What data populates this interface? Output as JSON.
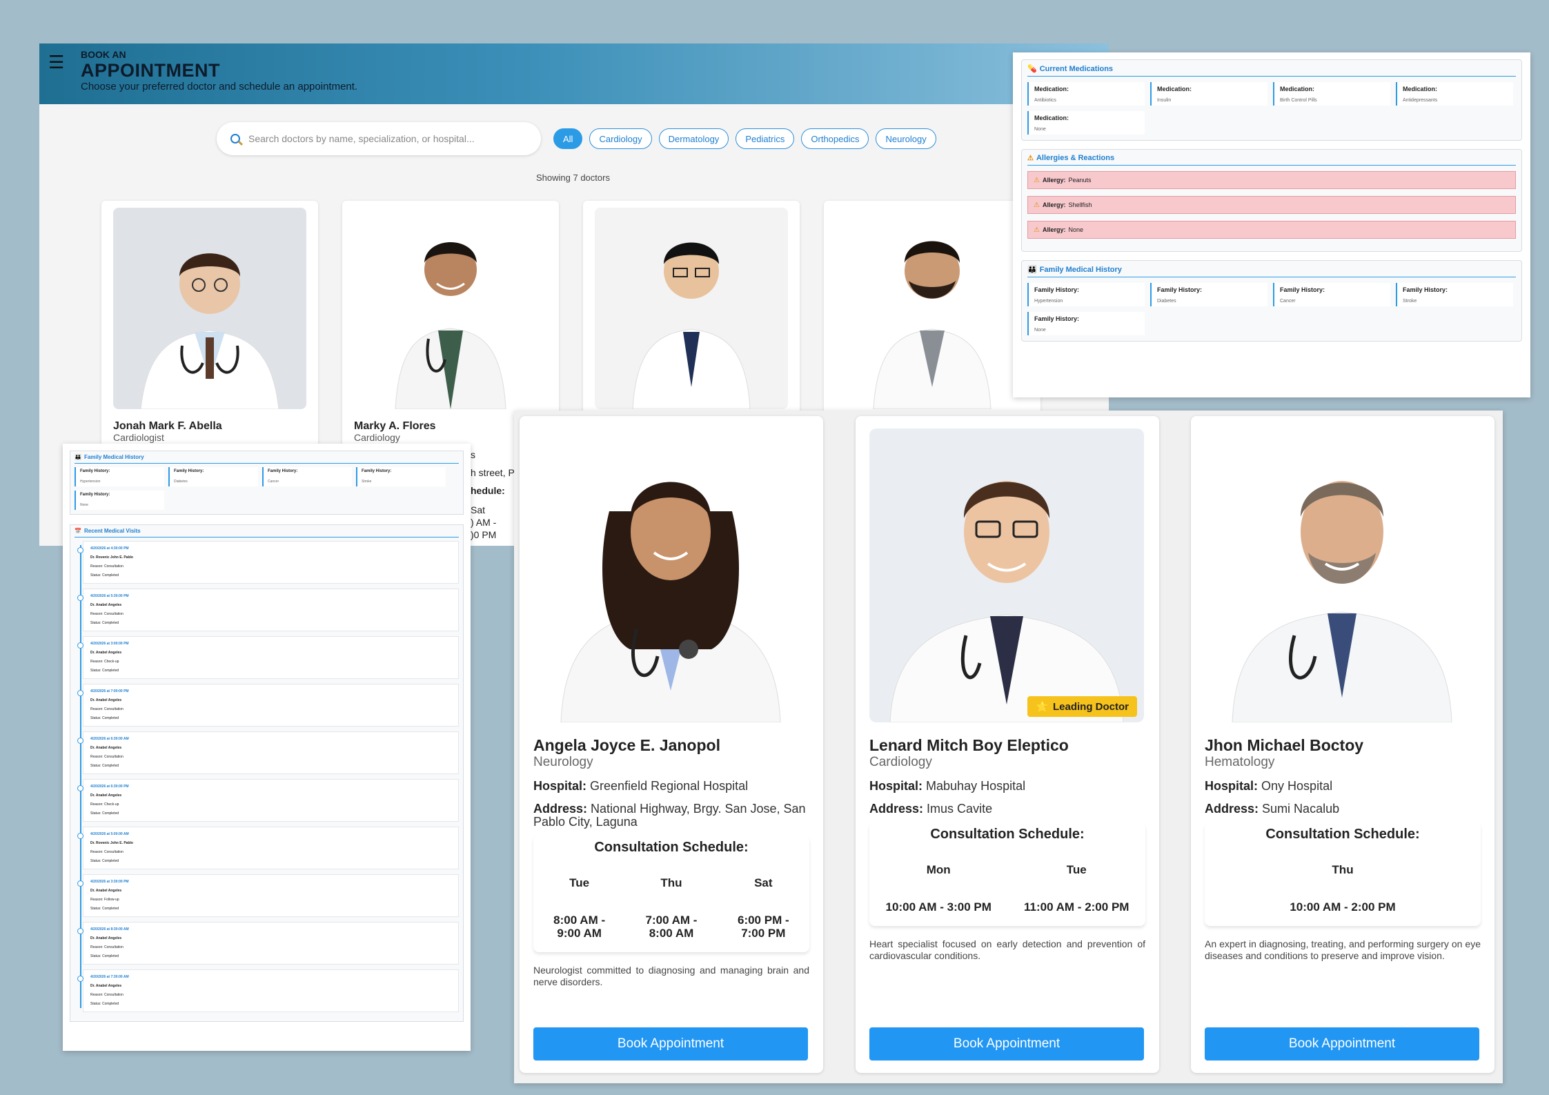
{
  "header": {
    "menu_icon": "hamburger-icon",
    "small_title": "BOOK AN",
    "title": "APPOINTMENT",
    "subtitle": "Choose your preferred doctor and schedule an appointment."
  },
  "search": {
    "placeholder": "Search doctors by name, specialization, or hospital..."
  },
  "filters": [
    "All",
    "Cardiology",
    "Dermatology",
    "Pediatrics",
    "Orthopedics",
    "Neurology"
  ],
  "showing": "Showing 7 doctors",
  "top_doctors": [
    {
      "name": "Jonah Mark F. Abella",
      "specialty": "Cardiologist"
    },
    {
      "name": "Marky A. Flores",
      "specialty": "Cardiology"
    },
    {
      "name": "",
      "specialty": ""
    },
    {
      "name": "",
      "specialty": ""
    }
  ],
  "peek": {
    "line1": "s",
    "line2": "h street, Pha",
    "line3": "hedule:",
    "line4": "Sat",
    "line5": ") AM -",
    "line6": ")0 PM"
  },
  "right_panel": {
    "medications_title": "Current Medications",
    "medications": [
      {
        "label": "Medication:",
        "value": "Antibiotics"
      },
      {
        "label": "Medication:",
        "value": "Insulin"
      },
      {
        "label": "Medication:",
        "value": "Birth Control Pills"
      },
      {
        "label": "Medication:",
        "value": "Antidepressants"
      },
      {
        "label": "Medication:",
        "value": "None"
      }
    ],
    "allergies_title": "Allergies & Reactions",
    "allergies": [
      {
        "label": "Allergy:",
        "value": "Peanuts"
      },
      {
        "label": "Allergy:",
        "value": "Shellfish"
      },
      {
        "label": "Allergy:",
        "value": "None"
      }
    ],
    "family_title": "Family Medical History",
    "family": [
      {
        "label": "Family History:",
        "value": "Hypertension"
      },
      {
        "label": "Family History:",
        "value": "Diabetes"
      },
      {
        "label": "Family History:",
        "value": "Cancer"
      },
      {
        "label": "Family History:",
        "value": "Stroke"
      },
      {
        "label": "Family History:",
        "value": "None"
      }
    ]
  },
  "left_panel": {
    "family_title": "Family Medical History",
    "family": [
      {
        "label": "Family History:",
        "value": "Hypertension"
      },
      {
        "label": "Family History:",
        "value": "Diabetes"
      },
      {
        "label": "Family History:",
        "value": "Cancer"
      },
      {
        "label": "Family History:",
        "value": "Stroke"
      },
      {
        "label": "Family History:",
        "value": "None"
      }
    ],
    "visits_title": "Recent Medical Visits",
    "visits": [
      {
        "date": "4/20/2026 at 4:30:00 PM",
        "doctor": "Dr. Rovenic John E. Pablo",
        "reason": "Reason: Consultation",
        "status": "Status: Completed"
      },
      {
        "date": "4/20/2026 at 5:30:00 PM",
        "doctor": "Dr. Anabel Angeles",
        "reason": "Reason: Consultation",
        "status": "Status: Completed"
      },
      {
        "date": "4/20/2026 at 3:00:00 PM",
        "doctor": "Dr. Anabel Angeles",
        "reason": "Reason: Check-up",
        "status": "Status: Completed"
      },
      {
        "date": "4/20/2026 at 7:00:00 PM",
        "doctor": "Dr. Anabel Angeles",
        "reason": "Reason: Consultation",
        "status": "Status: Completed"
      },
      {
        "date": "4/20/2026 at 6:30:00 AM",
        "doctor": "Dr. Anabel Angeles",
        "reason": "Reason: Consultation",
        "status": "Status: Completed"
      },
      {
        "date": "4/20/2026 at 6:30:00 PM",
        "doctor": "Dr. Anabel Angeles",
        "reason": "Reason: Check-up",
        "status": "Status: Completed"
      },
      {
        "date": "4/20/2026 at 5:00:00 AM",
        "doctor": "Dr. Rovenic John E. Pablo",
        "reason": "Reason: Consultation",
        "status": "Status: Completed"
      },
      {
        "date": "4/20/2026 at 3:30:00 PM",
        "doctor": "Dr. Anabel Angeles",
        "reason": "Reason: Follow-up",
        "status": "Status: Completed"
      },
      {
        "date": "4/20/2026 at 8:30:00 AM",
        "doctor": "Dr. Anabel Angeles",
        "reason": "Reason: Consultation",
        "status": "Status: Completed"
      },
      {
        "date": "4/20/2026 at 7:30:00 AM",
        "doctor": "Dr. Anabel Angeles",
        "reason": "Reason: Consultation",
        "status": "Status: Completed"
      }
    ]
  },
  "cards": [
    {
      "name": "Angela Joyce E. Janopol",
      "specialty": "Neurology",
      "hospital_label": "Hospital:",
      "hospital": "Greenfield Regional Hospital",
      "address_label": "Address:",
      "address": "National Highway, Brgy. San Jose, San Pablo City, Laguna",
      "schedule_title": "Consultation Schedule:",
      "days": [
        {
          "day": "Tue",
          "time": "8:00 AM - 9:00 AM"
        },
        {
          "day": "Thu",
          "time": "7:00 AM - 8:00 AM"
        },
        {
          "day": "Sat",
          "time": "6:00 PM - 7:00 PM"
        }
      ],
      "description": "Neurologist committed to diagnosing and managing brain and nerve disorders.",
      "button": "Book Appointment",
      "badge": ""
    },
    {
      "name": "Lenard Mitch Boy Eleptico",
      "specialty": "Cardiology",
      "hospital_label": "Hospital:",
      "hospital": "Mabuhay Hospital",
      "address_label": "Address:",
      "address": "Imus Cavite",
      "schedule_title": "Consultation Schedule:",
      "days": [
        {
          "day": "Mon",
          "time": "10:00 AM - 3:00 PM"
        },
        {
          "day": "Tue",
          "time": "11:00 AM - 2:00 PM"
        }
      ],
      "description": "Heart specialist focused on early detection and prevention of cardiovascular conditions.",
      "button": "Book Appointment",
      "badge": "Leading Doctor"
    },
    {
      "name": "Jhon Michael Boctoy",
      "specialty": "Hematology",
      "hospital_label": "Hospital:",
      "hospital": "Ony Hospital",
      "address_label": "Address:",
      "address": "Sumi Nacalub",
      "schedule_title": "Consultation Schedule:",
      "days": [
        {
          "day": "Thu",
          "time": "10:00 AM - 2:00 PM"
        }
      ],
      "description": "An expert in diagnosing, treating, and performing surgery on eye diseases and conditions to preserve and improve vision.",
      "button": "Book Appointment",
      "badge": ""
    }
  ]
}
